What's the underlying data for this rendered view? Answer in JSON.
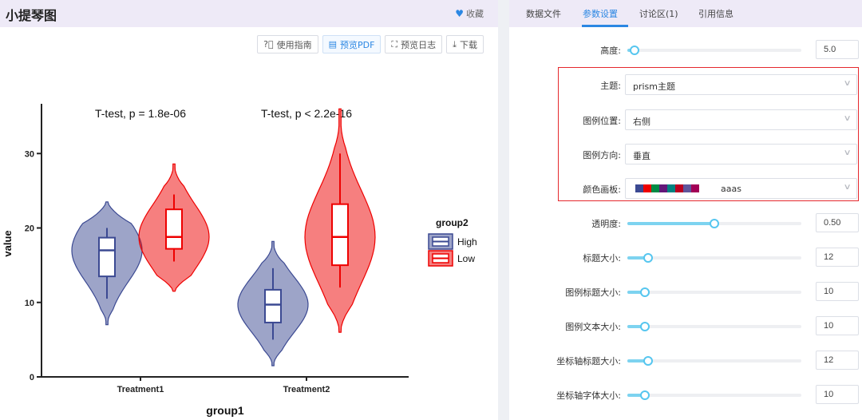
{
  "app": {
    "title": "小提琴图",
    "favorite_label": "收藏"
  },
  "toolbar": {
    "guide_label": "使用指南",
    "preview_pdf_label": "预览PDF",
    "preview_log_label": "预览日志",
    "download_label": "下载"
  },
  "tabs": [
    {
      "label": "数据文件",
      "active": false
    },
    {
      "label": "参数设置",
      "active": true
    },
    {
      "label": "讨论区(1)",
      "active": false
    },
    {
      "label": "引用信息",
      "active": false
    }
  ],
  "settings": {
    "height": {
      "label": "高度:",
      "value": "5.0",
      "slider_fraction": 0.04
    },
    "theme": {
      "label": "主题:",
      "value": "prism主题"
    },
    "legend_position": {
      "label": "图例位置:",
      "value": "右侧"
    },
    "legend_direction": {
      "label": "图例方向:",
      "value": "垂直"
    },
    "palette": {
      "label": "颜色画板:",
      "value": "aaas",
      "colors": [
        "#3b4992",
        "#ee0000",
        "#008b45",
        "#631879",
        "#008280",
        "#bb0021",
        "#5f559b",
        "#a20056"
      ]
    },
    "opacity": {
      "label": "透明度:",
      "value": "0.50",
      "slider_fraction": 0.5
    },
    "title_size": {
      "label": "标题大小:",
      "value": "12",
      "slider_fraction": 0.12
    },
    "legend_title_size": {
      "label": "图例标题大小:",
      "value": "10",
      "slider_fraction": 0.1
    },
    "legend_text_size": {
      "label": "图例文本大小:",
      "value": "10",
      "slider_fraction": 0.1
    },
    "axis_title_size": {
      "label": "坐标轴标题大小:",
      "value": "12",
      "slider_fraction": 0.12
    },
    "axis_font_size": {
      "label": "坐标轴字体大小:",
      "value": "10",
      "slider_fraction": 0.1
    }
  },
  "chart_data": {
    "type": "violin",
    "xlabel": "group1",
    "ylabel": "value",
    "categories": [
      "Treatment1",
      "Treatment2"
    ],
    "ylim": [
      0,
      37
    ],
    "yticks": [
      0,
      10,
      20,
      30
    ],
    "legend": {
      "title": "group2",
      "position": "right",
      "entries": [
        "High",
        "Low"
      ]
    },
    "annotations": [
      "T-test, p = 1.8e-06",
      "T-test, p < 2.2e-16"
    ],
    "colors": {
      "High": "#3b4992",
      "Low": "#ee0000"
    },
    "series": [
      {
        "name": "High",
        "boxes": [
          {
            "category": "Treatment1",
            "min": 10.5,
            "q1": 13.5,
            "median": 17,
            "q3": 18.7,
            "max": 20,
            "violin_min": 7,
            "violin_max": 23.5
          },
          {
            "category": "Treatment2",
            "min": 5,
            "q1": 7.3,
            "median": 9.7,
            "q3": 11.7,
            "max": 14.6,
            "violin_min": 1.5,
            "violin_max": 18.2
          }
        ]
      },
      {
        "name": "Low",
        "boxes": [
          {
            "category": "Treatment1",
            "min": 15.5,
            "q1": 17.2,
            "median": 18.8,
            "q3": 22.5,
            "max": 24.5,
            "violin_min": 11.5,
            "violin_max": 28.6
          },
          {
            "category": "Treatment2",
            "min": 12,
            "q1": 15,
            "median": 18.8,
            "q3": 23.2,
            "max": 30,
            "violin_min": 6,
            "violin_max": 36
          }
        ]
      }
    ]
  }
}
